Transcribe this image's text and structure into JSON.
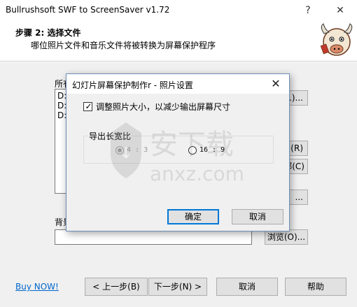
{
  "window": {
    "title": "Bullrushsoft SWF to ScreenSaver v1.72",
    "help_glyph": "?",
    "close_glyph": "✕"
  },
  "header": {
    "step": "步骤 2:  选择文件",
    "description": "哪位照片文件和音乐文件将被转换为屏幕保护程序"
  },
  "main": {
    "list_label": "所有",
    "list_items": [
      "D:",
      "D:",
      "D:"
    ],
    "side_buttons": [
      ".)...",
      "(R)",
      "部(C)",
      "..."
    ],
    "background_label": "背景",
    "background_value": "",
    "browse_label": "浏览(O)..."
  },
  "footer": {
    "buy_now": "Buy NOW!",
    "back_label": "< 上一步(B)",
    "next_label": "下一步(N) >",
    "cancel_label": "取消",
    "help_label": "帮助"
  },
  "dialog": {
    "title": "幻灯片屏幕保护制作r - 照片设置",
    "close_glyph": "✕",
    "resize_checkbox_label": "调整照片大小，以减少输出屏幕尺寸",
    "resize_checked": true,
    "aspect_group_label": "导出长宽比",
    "aspect_options": [
      {
        "label": "4 : 3",
        "selected": true,
        "enabled": false
      },
      {
        "label": "16 : 9",
        "selected": false,
        "enabled": true
      }
    ],
    "ok_label": "确定",
    "cancel_label": "取消"
  },
  "watermark": {
    "text_cn": "安下载",
    "text_en": "anxz.com"
  },
  "colors": {
    "dialog_border": "#6e8fb5",
    "primary_button_border": "#0078d7",
    "link": "#0066cc",
    "background": "#f0f0f0"
  }
}
